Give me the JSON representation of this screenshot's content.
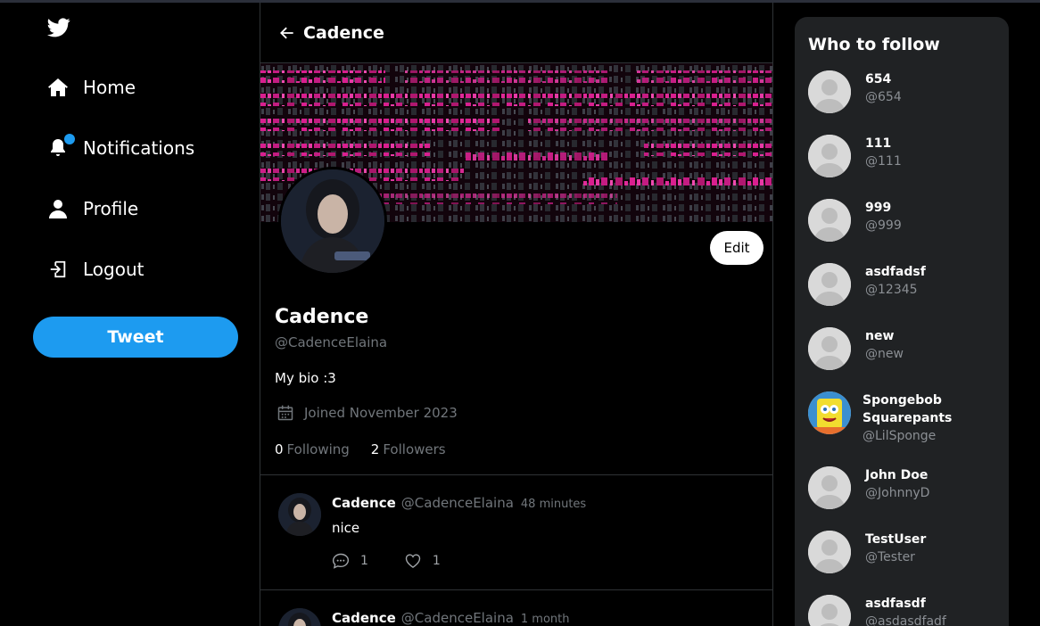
{
  "nav": {
    "items": [
      {
        "label": "Home",
        "icon": "home-icon"
      },
      {
        "label": "Notifications",
        "icon": "bell-icon"
      },
      {
        "label": "Profile",
        "icon": "user-icon"
      },
      {
        "label": "Logout",
        "icon": "logout-icon"
      }
    ],
    "tweet_button": "Tweet"
  },
  "header": {
    "title": "Cadence"
  },
  "profile": {
    "name": "Cadence",
    "handle": "@CadenceElaina",
    "bio": "My bio :3",
    "joined": "Joined November 2023",
    "following_count": "0",
    "following_label": "Following",
    "followers_count": "2",
    "followers_label": "Followers",
    "edit_label": "Edit"
  },
  "tweets": [
    {
      "name": "Cadence",
      "handle": "@CadenceElaina",
      "time": "48 minutes",
      "text": "nice",
      "replies": "1",
      "likes": "1"
    },
    {
      "name": "Cadence",
      "handle": "@CadenceElaina",
      "time": "1 month",
      "text": "",
      "replies": "",
      "likes": ""
    }
  ],
  "who_to_follow": {
    "title": "Who to follow",
    "users": [
      {
        "name": "654",
        "handle": "@654"
      },
      {
        "name": "111",
        "handle": "@111"
      },
      {
        "name": "999",
        "handle": "@999"
      },
      {
        "name": "asdfadsf",
        "handle": "@12345"
      },
      {
        "name": "new",
        "handle": "@new"
      },
      {
        "name": "Spongebob Squarepants",
        "handle": "@LilSponge"
      },
      {
        "name": "John Doe",
        "handle": "@JohnnyD"
      },
      {
        "name": "TestUser",
        "handle": "@Tester"
      },
      {
        "name": "asdfasdf",
        "handle": "@asdasdfadf"
      }
    ]
  },
  "colors": {
    "accent": "#1d9bf0",
    "banner_magenta": "#e0249a",
    "panel": "#202224"
  }
}
